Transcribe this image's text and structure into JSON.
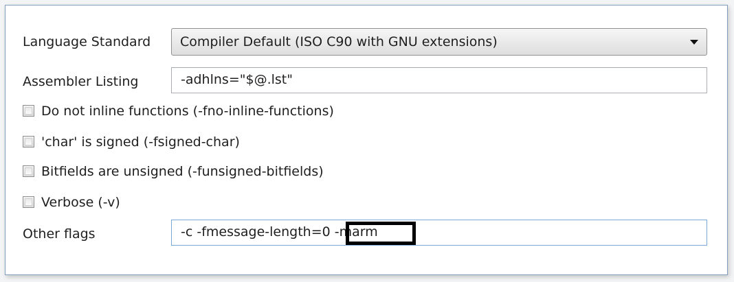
{
  "language_standard": {
    "label": "Language Standard",
    "selected": "Compiler Default (ISO C90 with GNU extensions)"
  },
  "assembler_listing": {
    "label": "Assembler Listing",
    "value": "-adhlns=\"$@.lst\""
  },
  "options": [
    {
      "label": "Do not inline functions (-fno-inline-functions)",
      "checked": false
    },
    {
      "label": "'char' is signed (-fsigned-char)",
      "checked": false
    },
    {
      "label": "Bitfields are unsigned (-funsigned-bitfields)",
      "checked": false
    },
    {
      "label": "Verbose (-v)",
      "checked": false
    }
  ],
  "other_flags": {
    "label": "Other flags",
    "value": "-c -fmessage-length=0 -marm"
  }
}
